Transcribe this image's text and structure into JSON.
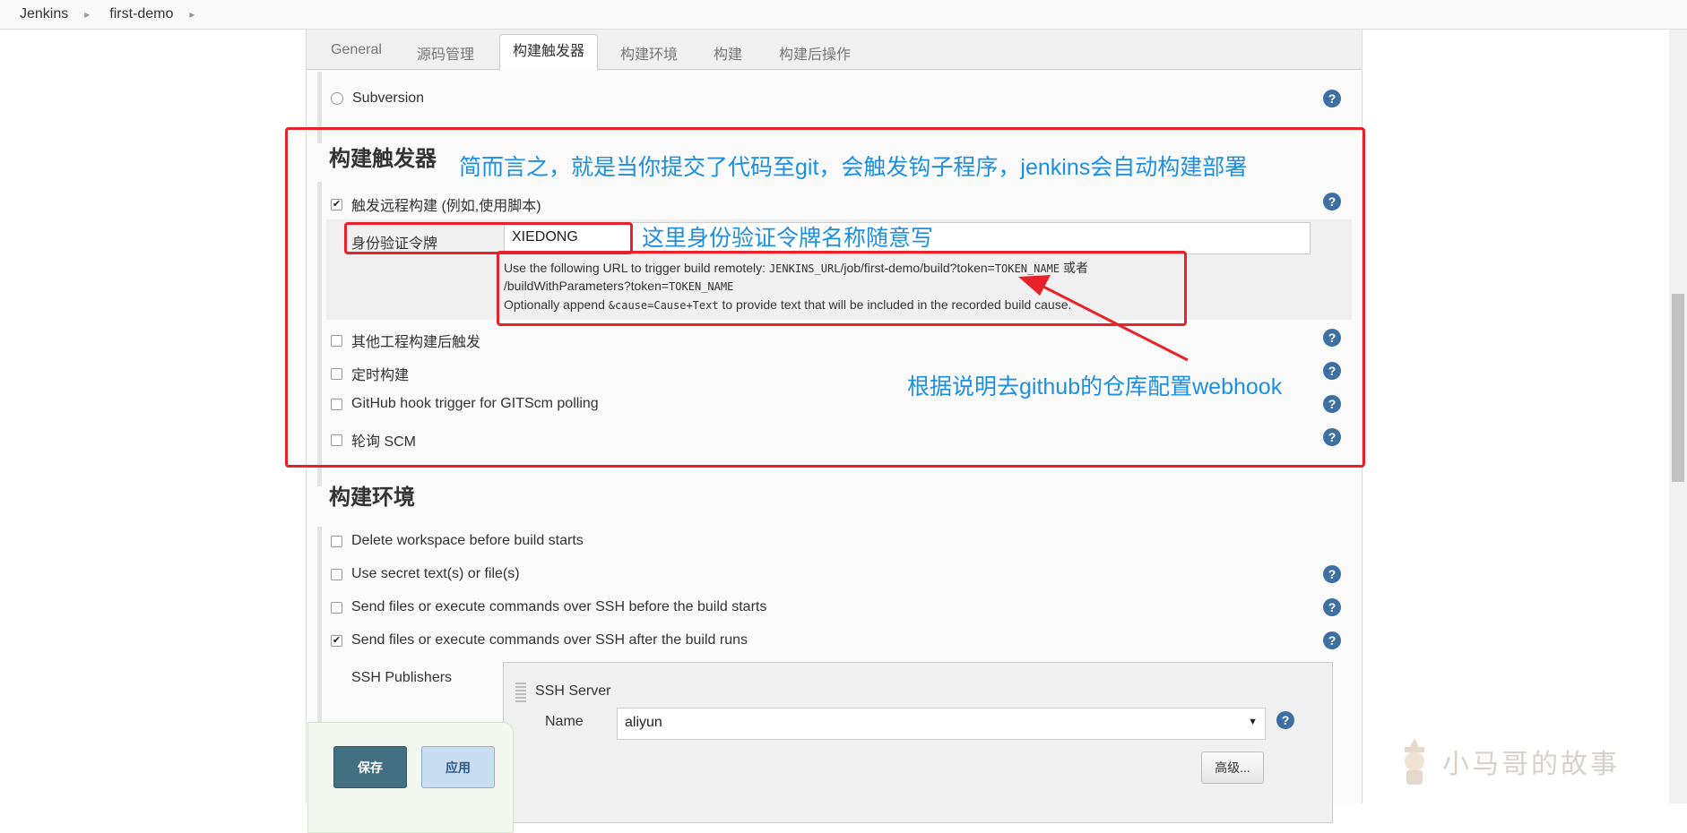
{
  "breadcrumb": {
    "items": [
      "Jenkins",
      "first-demo"
    ],
    "separator": "▸"
  },
  "tabs": [
    {
      "label": "General"
    },
    {
      "label": "源码管理"
    },
    {
      "label": "构建触发器",
      "active": true
    },
    {
      "label": "构建环境"
    },
    {
      "label": "构建"
    },
    {
      "label": "构建后操作"
    }
  ],
  "source_control": {
    "subversion_label": "Subversion"
  },
  "triggers": {
    "title": "构建触发器",
    "remote_build_label": "触发远程构建 (例如,使用脚本)",
    "token_label": "身份验证令牌",
    "token_value": "XIEDONG",
    "desc_line1_prefix": "Use the following URL to trigger build remotely: ",
    "desc_line1_code": "JENKINS_URL",
    "desc_line1_path": "/job/first-demo/build?token=",
    "desc_line1_code2": "TOKEN_NAME",
    "desc_line1_or": " 或者",
    "desc_line2_path": "/buildWithParameters?token=",
    "desc_line2_code": "TOKEN_NAME",
    "desc_line3_prefix": "Optionally append ",
    "desc_line3_code": "&cause=Cause+Text",
    "desc_line3_suffix": " to provide text that will be included in the recorded build cause.",
    "other_project_label": "其他工程构建后触发",
    "periodic_label": "定时构建",
    "github_hook_label": "GitHub hook trigger for GITScm polling",
    "poll_scm_label": "轮询 SCM"
  },
  "build_env": {
    "title": "构建环境",
    "delete_ws_label": "Delete workspace before build starts",
    "secret_label": "Use secret text(s) or file(s)",
    "ssh_before_label": "Send files or execute commands over SSH before the build starts",
    "ssh_after_label": "Send files or execute commands over SSH after the build runs",
    "ssh_publishers_label": "SSH Publishers",
    "ssh_server_label": "SSH Server",
    "name_label": "Name",
    "name_value": "aliyun",
    "advanced_label": "高级..."
  },
  "actions": {
    "save_label": "保存",
    "apply_label": "应用"
  },
  "annotations": {
    "summary": "简而言之，就是当你提交了代码至git，会触发钩子程序，jenkins会自动构建部署",
    "token_note": "这里身份验证令牌名称随意写",
    "webhook_note": "根据说明去github的仓库配置webhook"
  },
  "watermark": {
    "text": "小马哥的故事"
  },
  "colors": {
    "annotation": "#1c8fe3",
    "highlight": "#e8222a",
    "help": "#3d6fa3",
    "save": "#437080"
  }
}
